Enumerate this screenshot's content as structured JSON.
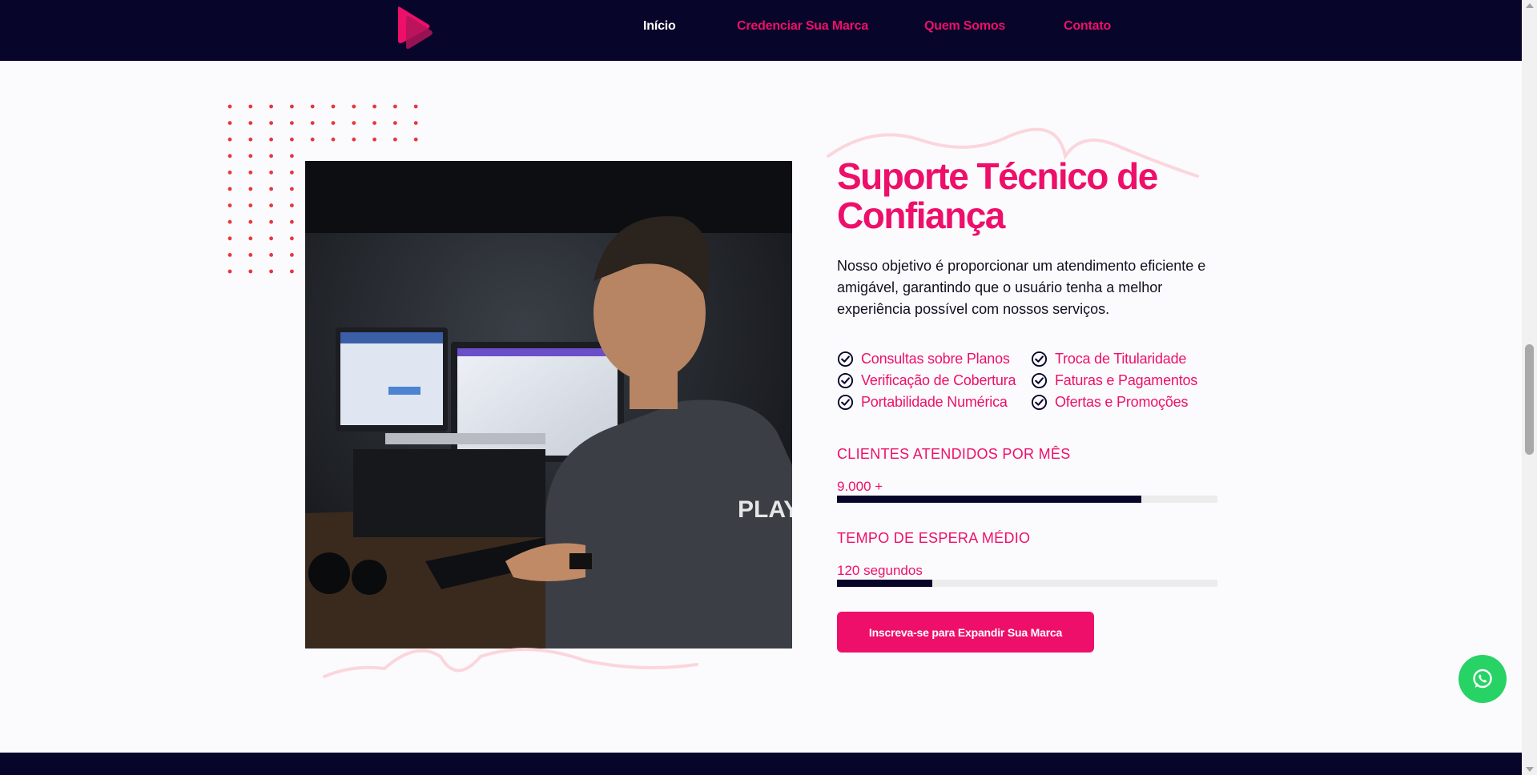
{
  "header": {
    "logo_icon": "play-logo-icon",
    "nav": [
      {
        "label": "Início",
        "active": true
      },
      {
        "label": "Credenciar Sua Marca",
        "active": false
      },
      {
        "label": "Quem Somos",
        "active": false
      },
      {
        "label": "Contato",
        "active": false
      }
    ]
  },
  "hero": {
    "title": "Suporte Técnico de Confiança",
    "description": "Nosso objetivo é proporcionar um atendimento eficiente e amigável, garantindo que o usuário tenha a melhor experiência possível com nossos serviços.",
    "photo_overlay_text": "PLAY",
    "features": [
      "Consultas sobre Planos",
      "Troca de Titularidade",
      "Verificação de Cobertura",
      "Faturas e Pagamentos",
      "Portabilidade Numérica",
      "Ofertas e Promoções"
    ],
    "stats": [
      {
        "title": "CLIENTES ATENDIDOS POR MÊS",
        "value": "9.000 +",
        "progress": 0.8
      },
      {
        "title": "TEMPO DE ESPERA MÉDIO",
        "value": "120 segundos",
        "progress": 0.25
      }
    ],
    "cta_label": "Inscreva-se para Expandir Sua Marca"
  },
  "floating": {
    "icon": "whatsapp-icon"
  },
  "colors": {
    "primary": "#ee0f6a",
    "navy": "#07062a",
    "whatsapp": "#28d366",
    "dots": "#e8363c"
  }
}
